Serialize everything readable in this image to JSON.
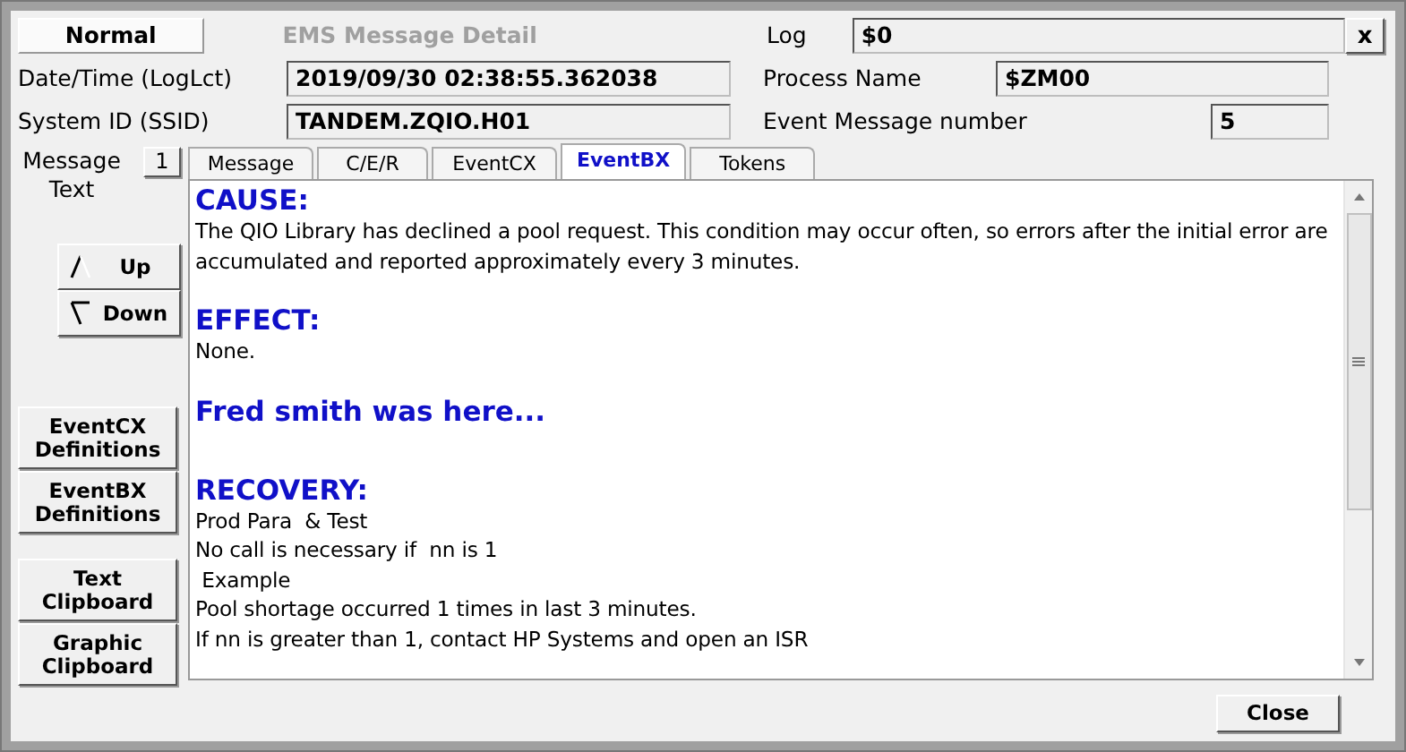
{
  "status": {
    "text": "Normal"
  },
  "window": {
    "title": "EMS Message Detail"
  },
  "close_x": {
    "label": "x"
  },
  "fields": [
    {
      "label": "Log",
      "value": "$0"
    },
    {
      "label": "Date/Time (LogLct)",
      "value": "2019/09/30 02:38:55.362038"
    },
    {
      "label": "Process Name",
      "value": "$ZM00"
    },
    {
      "label": "System ID (SSID)",
      "value": "TANDEM.ZQIO.H01"
    },
    {
      "label": "Event Message number",
      "value": "5"
    }
  ],
  "message_text": {
    "label": "Message Text",
    "count": "1"
  },
  "tabs": [
    {
      "label": "Message",
      "selected": false
    },
    {
      "label": "C/E/R",
      "selected": false
    },
    {
      "label": "EventCX",
      "selected": false
    },
    {
      "label": "EventBX",
      "selected": true
    },
    {
      "label": "Tokens",
      "selected": false
    }
  ],
  "content": [
    {
      "kind": "heading",
      "text": "CAUSE:"
    },
    {
      "kind": "text",
      "text": "The QIO Library has declined a pool request. This condition may occur often, so errors after the initial error are accumulated and reported approximately every 3 minutes."
    },
    {
      "kind": "heading",
      "text": "EFFECT:"
    },
    {
      "kind": "text",
      "text": "None."
    },
    {
      "kind": "heading",
      "text": "Fred smith was here..."
    },
    {
      "kind": "heading",
      "text": "RECOVERY:"
    },
    {
      "kind": "text",
      "text": "Prod Para  & Test"
    },
    {
      "kind": "text",
      "text": "No call is necessary if  nn is 1"
    },
    {
      "kind": "text",
      "text": " Example"
    },
    {
      "kind": "text",
      "text": "Pool shortage occurred 1 times in last 3 minutes."
    },
    {
      "kind": "text",
      "text": "If nn is greater than 1, contact HP Systems and open an ISR"
    }
  ],
  "nav_buttons": [
    {
      "kind": "up",
      "label": "Up"
    },
    {
      "kind": "down",
      "label": "Down"
    }
  ],
  "side_buttons": [
    {
      "label": "EventCX Definitions"
    },
    {
      "label": "EventBX Definitions"
    },
    {
      "label": "Text Clipboard"
    },
    {
      "label": "Graphic Clipboard"
    }
  ],
  "close_button": {
    "label": "Close"
  }
}
